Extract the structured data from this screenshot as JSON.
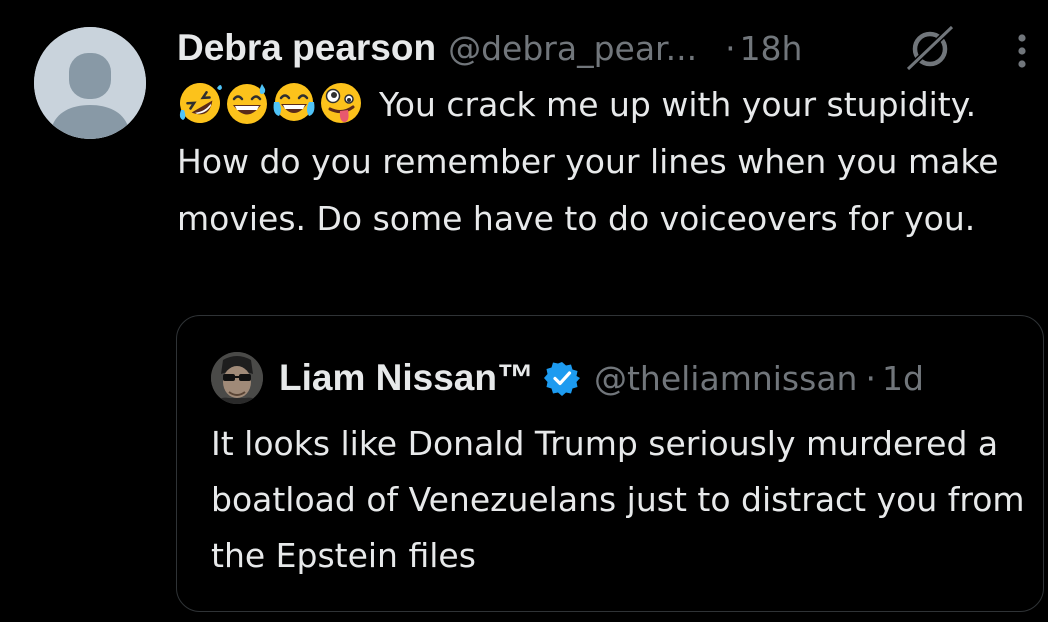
{
  "tweet": {
    "author": {
      "display_name": "Debra pearson",
      "handle": "@debra_pear...",
      "avatar_icon": "default-avatar-icon"
    },
    "separator": "·",
    "time": "18h",
    "emojis": [
      "rolling-on-floor-laughing",
      "grinning-sweat",
      "tears-of-joy",
      "zany-face"
    ],
    "text": "You crack me up with your stupidity. How do you remember your lines when you make movies. Do some have to do voiceovers for you.",
    "icons": {
      "grok": "grok-icon",
      "more": "more-icon"
    }
  },
  "quoted_tweet": {
    "author": {
      "display_name": "Liam Nissan™",
      "handle": "@theliamnissan",
      "verified": true
    },
    "separator": "·",
    "time": "1d",
    "text": "It looks like Donald Trump seriously murdered a boatload of Venezuelans just to distract you from the Epstein files"
  },
  "colors": {
    "background": "#000000",
    "primary_text": "#e7e9ea",
    "secondary_text": "#71767b",
    "border": "#2f3336",
    "verified_blue": "#1d9bf0",
    "avatar_bg": "#c9d3dc",
    "avatar_fg": "#8899a6"
  }
}
